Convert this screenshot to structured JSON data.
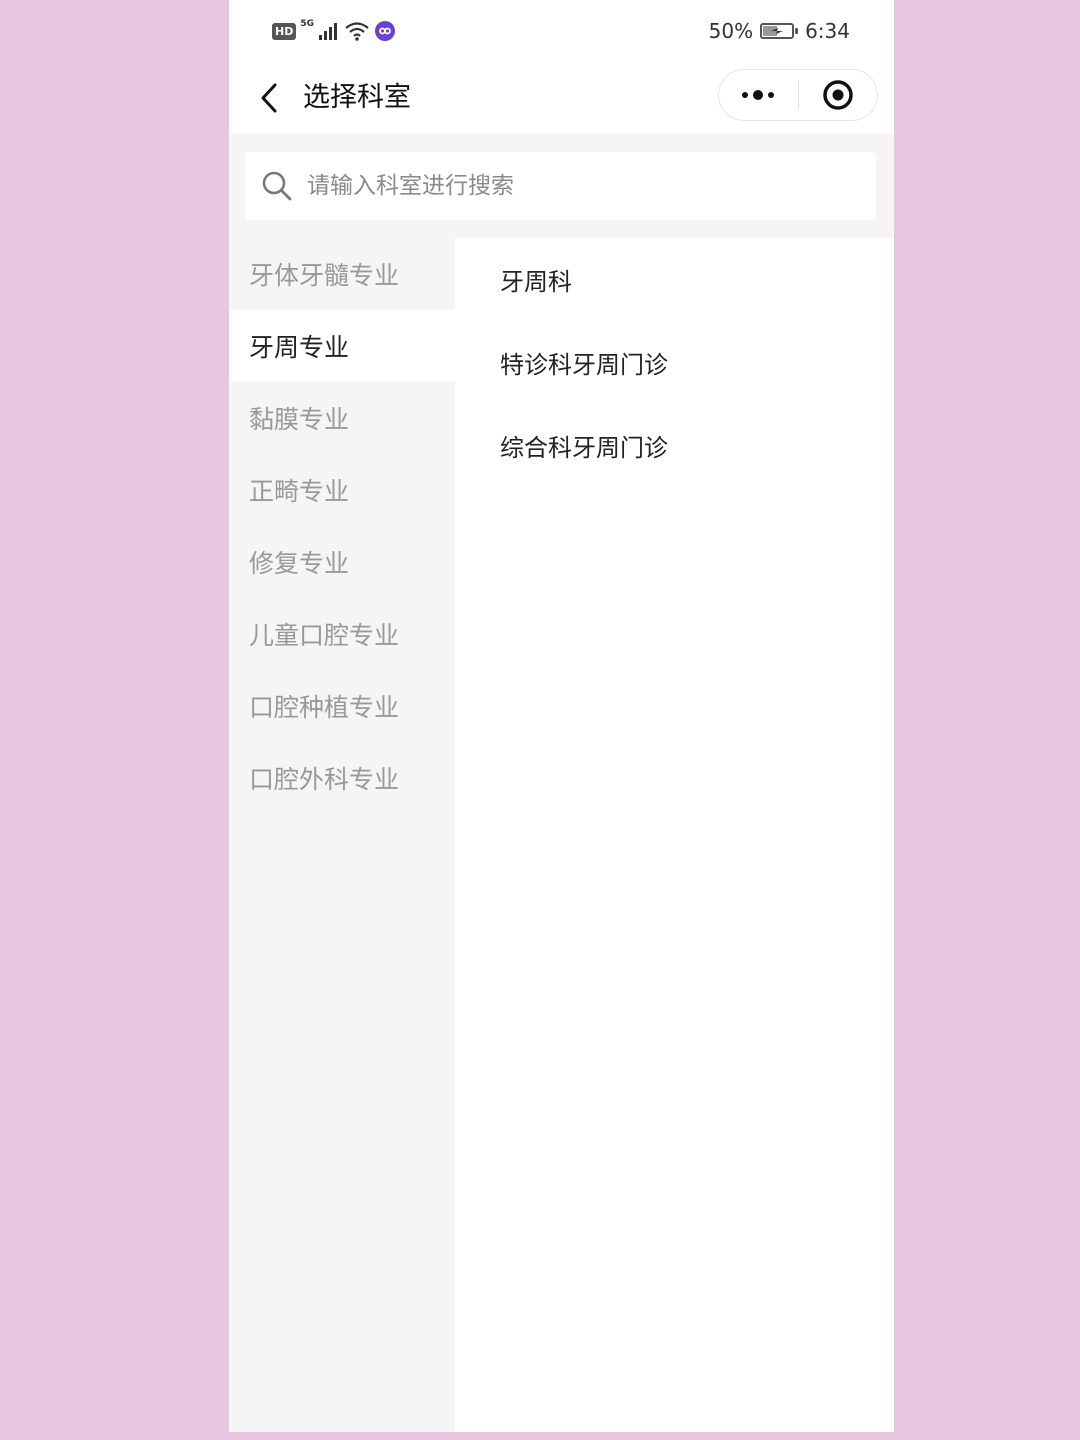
{
  "status_bar": {
    "hd": "HD",
    "network": "5G",
    "battery_percent": "50%",
    "battery_level": 0.5,
    "time": "6:34"
  },
  "nav": {
    "title": "选择科室",
    "icons": {
      "back": "chevron-left-icon",
      "more": "more-dots-icon",
      "close": "target-circle-icon"
    }
  },
  "search": {
    "placeholder": "请输入科室进行搜索",
    "value": ""
  },
  "categories": [
    {
      "label": "牙体牙髓专业",
      "active": false
    },
    {
      "label": "牙周专业",
      "active": true
    },
    {
      "label": "黏膜专业",
      "active": false
    },
    {
      "label": "正畸专业",
      "active": false
    },
    {
      "label": "修复专业",
      "active": false
    },
    {
      "label": "儿童口腔专业",
      "active": false
    },
    {
      "label": "口腔种植专业",
      "active": false
    },
    {
      "label": "口腔外科专业",
      "active": false
    }
  ],
  "departments": [
    {
      "label": "牙周科"
    },
    {
      "label": "特诊科牙周门诊"
    },
    {
      "label": "综合科牙周门诊"
    }
  ],
  "colors": {
    "page_background": "#e8c6df",
    "menu_background": "#f5f5f5",
    "active_text": "#222222",
    "inactive_text": "#999999"
  }
}
